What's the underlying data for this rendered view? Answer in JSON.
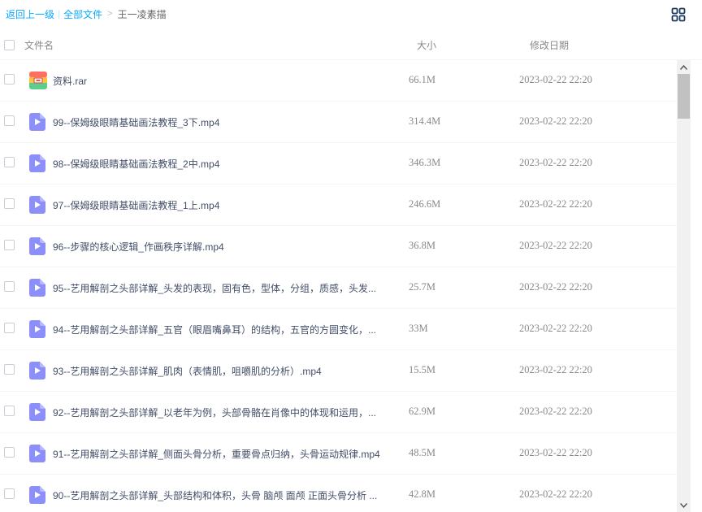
{
  "breadcrumb": {
    "back": "返回上一级",
    "separator": "|",
    "all_files": "全部文件",
    "arrow": ">",
    "current": "王一凌素描"
  },
  "header": {
    "name": "文件名",
    "size": "大小",
    "date": "修改日期"
  },
  "colors": {
    "link": "#09aaff",
    "video_icon": "#8c8ffa",
    "text": "#424e67",
    "muted": "#888888"
  },
  "files": [
    {
      "icon": "archive-icon",
      "name": "资料.rar",
      "size": "66.1M",
      "date": "2023-02-22 22:20"
    },
    {
      "icon": "video-icon",
      "name": "99--保姆级眼睛基础画法教程_3下.mp4",
      "size": "314.4M",
      "date": "2023-02-22 22:20"
    },
    {
      "icon": "video-icon",
      "name": "98--保姆级眼睛基础画法教程_2中.mp4",
      "size": "346.3M",
      "date": "2023-02-22 22:20"
    },
    {
      "icon": "video-icon",
      "name": "97--保姆级眼睛基础画法教程_1上.mp4",
      "size": "246.6M",
      "date": "2023-02-22 22:20"
    },
    {
      "icon": "video-icon",
      "name": "96--步骤的核心逻辑_作画秩序详解.mp4",
      "size": "36.8M",
      "date": "2023-02-22 22:20"
    },
    {
      "icon": "video-icon",
      "name": "95--艺用解剖之头部详解_头发的表现，固有色，型体，分组，质感，头发...",
      "size": "25.7M",
      "date": "2023-02-22 22:20"
    },
    {
      "icon": "video-icon",
      "name": "94--艺用解剖之头部详解_五官（眼眉嘴鼻耳）的结构，五官的方圆变化，...",
      "size": "33M",
      "date": "2023-02-22 22:20"
    },
    {
      "icon": "video-icon",
      "name": "93--艺用解剖之头部详解_肌肉（表情肌，咀嚼肌的分析）.mp4",
      "size": "15.5M",
      "date": "2023-02-22 22:20"
    },
    {
      "icon": "video-icon",
      "name": "92--艺用解剖之头部详解_以老年为例，头部骨骼在肖像中的体现和运用，...",
      "size": "62.9M",
      "date": "2023-02-22 22:20"
    },
    {
      "icon": "video-icon",
      "name": "91--艺用解剖之头部详解_侧面头骨分析，重要骨点归纳，头骨运动规律.mp4",
      "size": "48.5M",
      "date": "2023-02-22 22:20"
    },
    {
      "icon": "video-icon",
      "name": "90--艺用解剖之头部详解_头部结构和体积，头骨 脑颅 面颅 正面头骨分析 ...",
      "size": "42.8M",
      "date": "2023-02-22 22:20"
    }
  ]
}
